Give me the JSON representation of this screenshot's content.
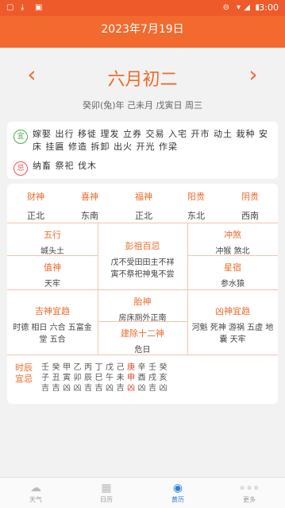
{
  "status_bar": {
    "time": "3:00"
  },
  "title": "2023年7月19日",
  "lunar_date": "六月初二",
  "ganzhi": "癸卯(兔)年  己未月  戊寅日  周三",
  "yi": {
    "badge": "宜",
    "items": "嫁娶 出行 移徙 理发 立券 交易 入宅 开市 动土 栽种 安床 挂匾 修造 拆卸 出火 开光 作梁"
  },
  "ji": {
    "badge": "忌",
    "items": "纳畜 祭祀 伐木"
  },
  "gods": [
    {
      "title": "财神",
      "value": "正北"
    },
    {
      "title": "喜神",
      "value": "东南"
    },
    {
      "title": "福神",
      "value": "正北"
    },
    {
      "title": "阳贵",
      "value": "东北"
    },
    {
      "title": "阴贵",
      "value": "西南"
    }
  ],
  "wuxing": {
    "title": "五行",
    "value": "城头土"
  },
  "pengzu": {
    "title": "彭祖百忌",
    "line1": "戊不受田田主不祥",
    "line2": "寅不祭祀神鬼不尝"
  },
  "chongsha": {
    "title": "冲煞",
    "value": "冲猴 煞北"
  },
  "zhishen": {
    "title": "值神",
    "value": "天牢"
  },
  "xingsu": {
    "title": "星宿",
    "value": "参水猿"
  },
  "taishen": {
    "title": "胎神",
    "value": "房床厕外正南"
  },
  "jishen": {
    "title": "吉神宜趋",
    "value": "时德 相日 六合 五富金堂 五合"
  },
  "xiongshen": {
    "title": "凶神宜趋",
    "value": "河魁 死神 游祸 五虚 地囊 天牢"
  },
  "jianchu": {
    "title": "建除十二神",
    "value": "危日"
  },
  "hours": {
    "label": "时辰宜忌",
    "columns": [
      {
        "top": "壬",
        "mid": "子",
        "bot": "吉",
        "red": false
      },
      {
        "top": "癸",
        "mid": "丑",
        "bot": "吉",
        "red": false
      },
      {
        "top": "甲",
        "mid": "寅",
        "bot": "凶",
        "red": false
      },
      {
        "top": "乙",
        "mid": "卯",
        "bot": "凶",
        "red": false
      },
      {
        "top": "丙",
        "mid": "辰",
        "bot": "吉",
        "red": false
      },
      {
        "top": "丁",
        "mid": "巳",
        "bot": "吉",
        "red": false
      },
      {
        "top": "戊",
        "mid": "午",
        "bot": "凶",
        "red": false
      },
      {
        "top": "己",
        "mid": "未",
        "bot": "吉",
        "red": false
      },
      {
        "top": "庚",
        "mid": "申",
        "bot": "凶",
        "red": true
      },
      {
        "top": "辛",
        "mid": "酉",
        "bot": "凶",
        "red": false
      },
      {
        "top": "壬",
        "mid": "戌",
        "bot": "吉",
        "red": false
      },
      {
        "top": "癸",
        "mid": "亥",
        "bot": "凶",
        "red": false
      }
    ]
  },
  "tabs": [
    {
      "label": "天气",
      "icon": "weather-icon"
    },
    {
      "label": "日历",
      "icon": "calendar-icon"
    },
    {
      "label": "黄历",
      "icon": "almanac-icon",
      "active": true
    },
    {
      "label": "更多",
      "icon": "more-icon"
    }
  ],
  "colors": {
    "accent": "#ee6a2b",
    "active_tab": "#2f7fd8"
  }
}
